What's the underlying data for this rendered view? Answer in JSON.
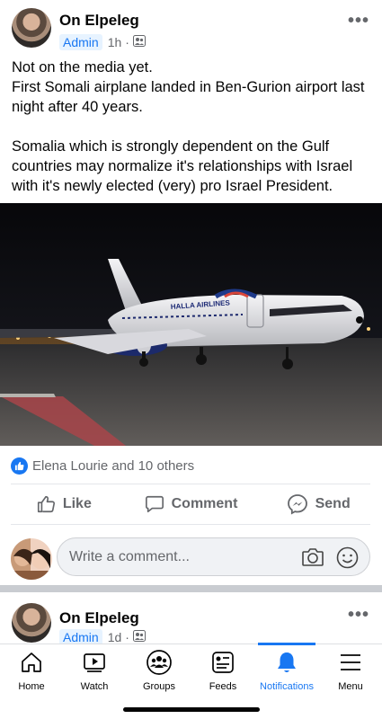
{
  "post": {
    "author": "On Elpeleg",
    "badge": "Admin",
    "time": "1h",
    "text": "Not on the media yet.\nFirst Somali airplane landed in Ben-Gurion airport last night after 40 years.\n\nSomalia which is strongly dependent on the Gulf countries may normalize it's relationships with Israel with it's newly elected (very) pro Israel President.",
    "reactions_text": "Elena Lourie and 10 others",
    "actions": {
      "like": "Like",
      "comment": "Comment",
      "send": "Send"
    },
    "comment_placeholder": "Write a comment...",
    "photo_livery": "HALLA AIRLINES"
  },
  "next_post": {
    "author": "On Elpeleg",
    "badge": "Admin",
    "time": "1d"
  },
  "tabs": [
    {
      "label": "Home",
      "icon": "home-icon"
    },
    {
      "label": "Watch",
      "icon": "video-icon"
    },
    {
      "label": "Groups",
      "icon": "groups-icon"
    },
    {
      "label": "Feeds",
      "icon": "feeds-icon"
    },
    {
      "label": "Notifications",
      "icon": "bell-icon",
      "active": true
    },
    {
      "label": "Menu",
      "icon": "hamburger-icon"
    }
  ],
  "colors": {
    "accent": "#1877f2",
    "text": "#050505",
    "secondary": "#65676b",
    "badge_bg": "#e7f3ff"
  }
}
